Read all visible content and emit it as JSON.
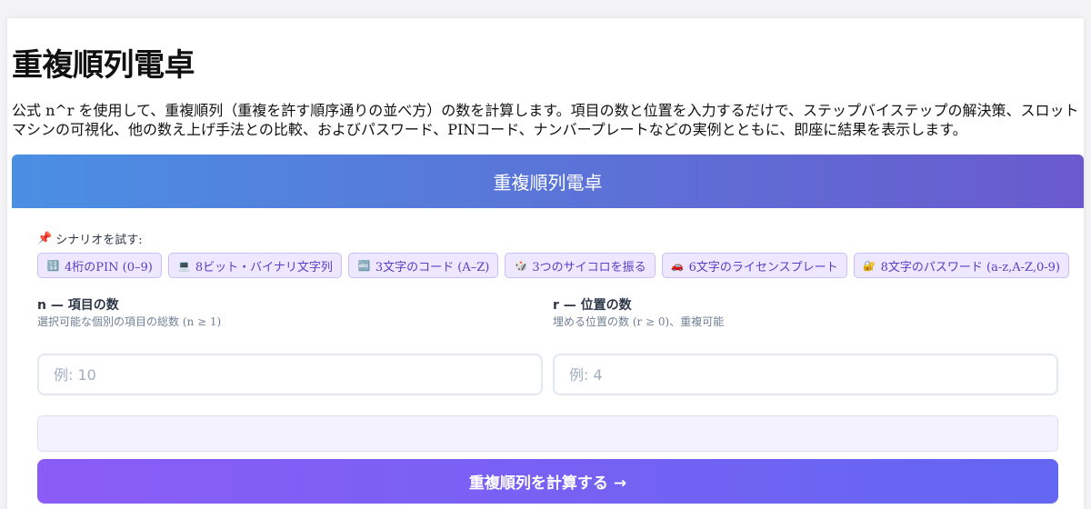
{
  "page": {
    "title": "重複順列電卓",
    "intro": "公式 n^r を使用して、重複順列（重複を許す順序通りの並べ方）の数を計算します。項目の数と位置を入力するだけで、ステップバイステップの解決策、スロットマシンの可視化、他の数え上げ手法との比較、およびパスワード、PINコード、ナンバープレートなどの実例とともに、即座に結果を表示します。"
  },
  "calculator": {
    "header_title": "重複順列電卓",
    "scenario_label": "シナリオを試す:",
    "scenario_icon": "pushpin-icon",
    "scenarios": [
      {
        "icon": "🔢",
        "label": "4桁のPIN (0–9)"
      },
      {
        "icon": "💻",
        "label": "8ビット・バイナリ文字列"
      },
      {
        "icon": "🔤",
        "label": "3文字のコード (A–Z)"
      },
      {
        "icon": "🎲",
        "label": "3つのサイコロを振る"
      },
      {
        "icon": "🚗",
        "label": "6文字のライセンスプレート"
      },
      {
        "icon": "🔐",
        "label": "8文字のパスワード (a-z,A-Z,0-9)"
      }
    ],
    "n_field": {
      "label": "n — 項目の数",
      "hint": "選択可能な個別の項目の総数 (n ≥ 1)",
      "placeholder": "例: 10",
      "value": ""
    },
    "r_field": {
      "label": "r — 位置の数",
      "hint": "埋める位置の数 (r ≥ 0)、重複可能",
      "placeholder": "例: 4",
      "value": ""
    },
    "submit_label": "重複順列を計算する →"
  },
  "colors": {
    "header_gradient_start": "#4a8fe3",
    "header_gradient_end": "#6a5acd",
    "button_gradient_start": "#8b5cf6",
    "button_gradient_end": "#6366f1",
    "chip_background": "#ede8ff",
    "chip_text": "#5b3cc4"
  }
}
